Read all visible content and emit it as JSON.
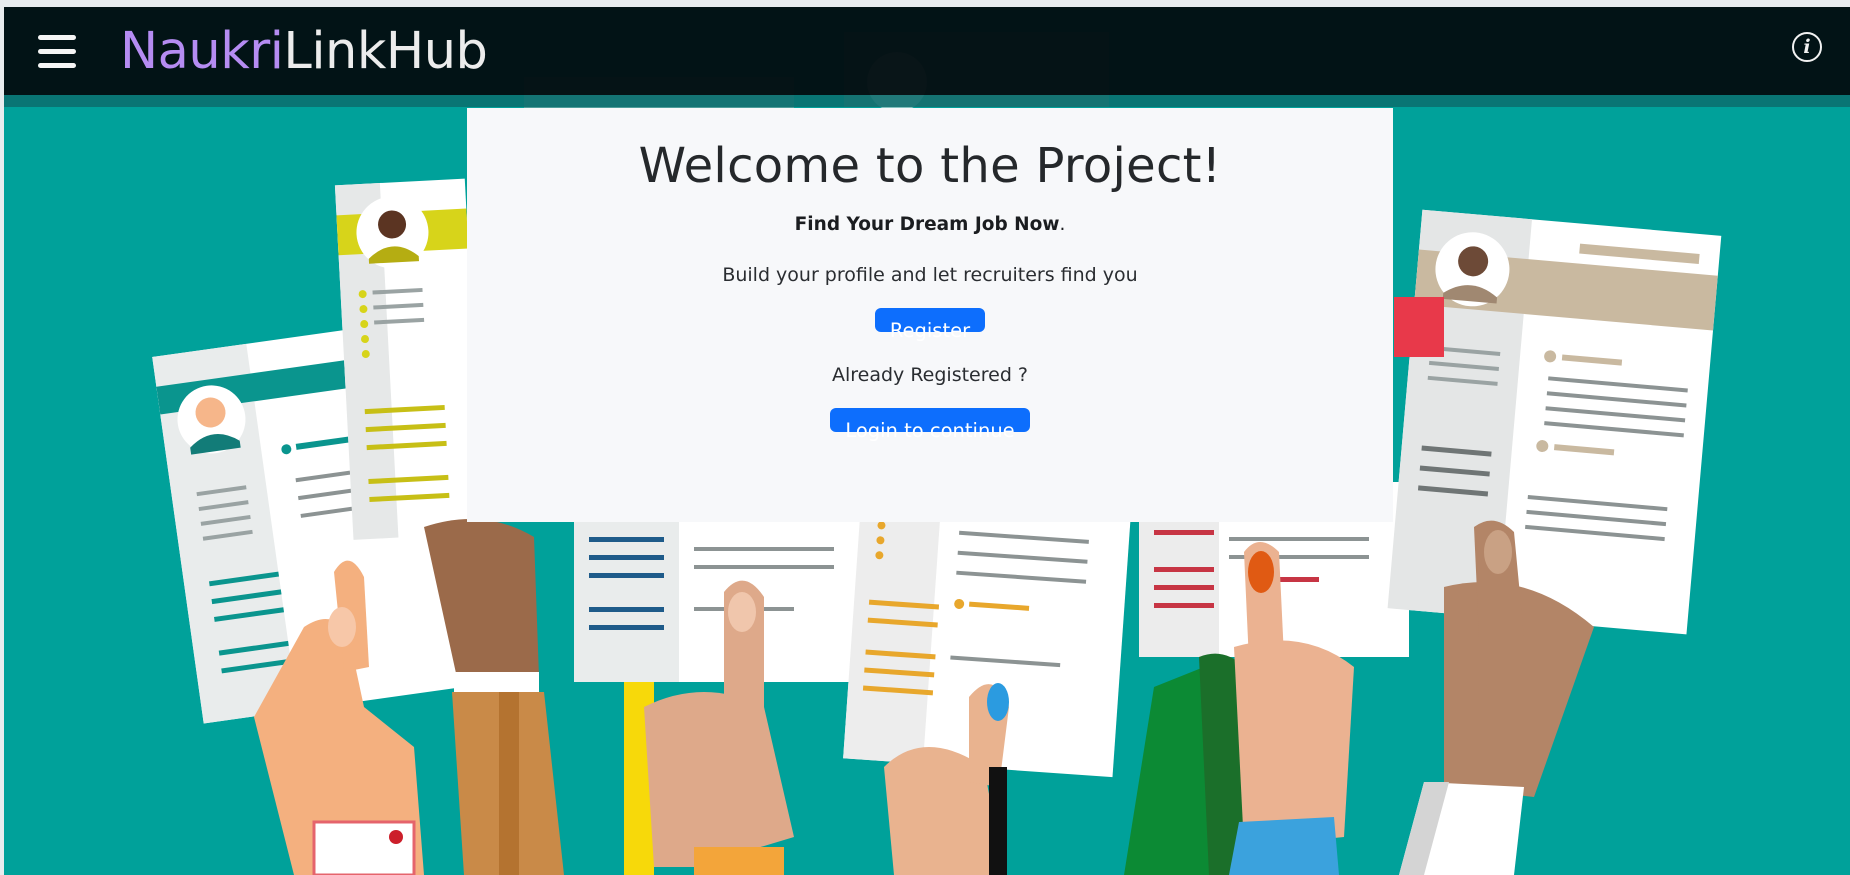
{
  "navbar": {
    "brand_part1": "Naukri",
    "brand_part2": "LinkHub",
    "menu_icon": "hamburger-menu-icon",
    "info_icon": "info-circle-icon",
    "info_glyph": "i"
  },
  "hero": {
    "title": "Welcome to the Project!",
    "tagline_bold": "Find Your Dream Job Now",
    "tagline_end": ".",
    "subtext": "Build your profile and let recruiters find you",
    "register_label": "Register",
    "already_text": "Already Registered ?",
    "login_label": "Login to continue"
  },
  "colors": {
    "background_teal": "#00a19a",
    "navbar": "#020e11",
    "brand_accent": "#b58cf2",
    "primary_button": "#0d6efd",
    "card": "#f7f8fa"
  }
}
